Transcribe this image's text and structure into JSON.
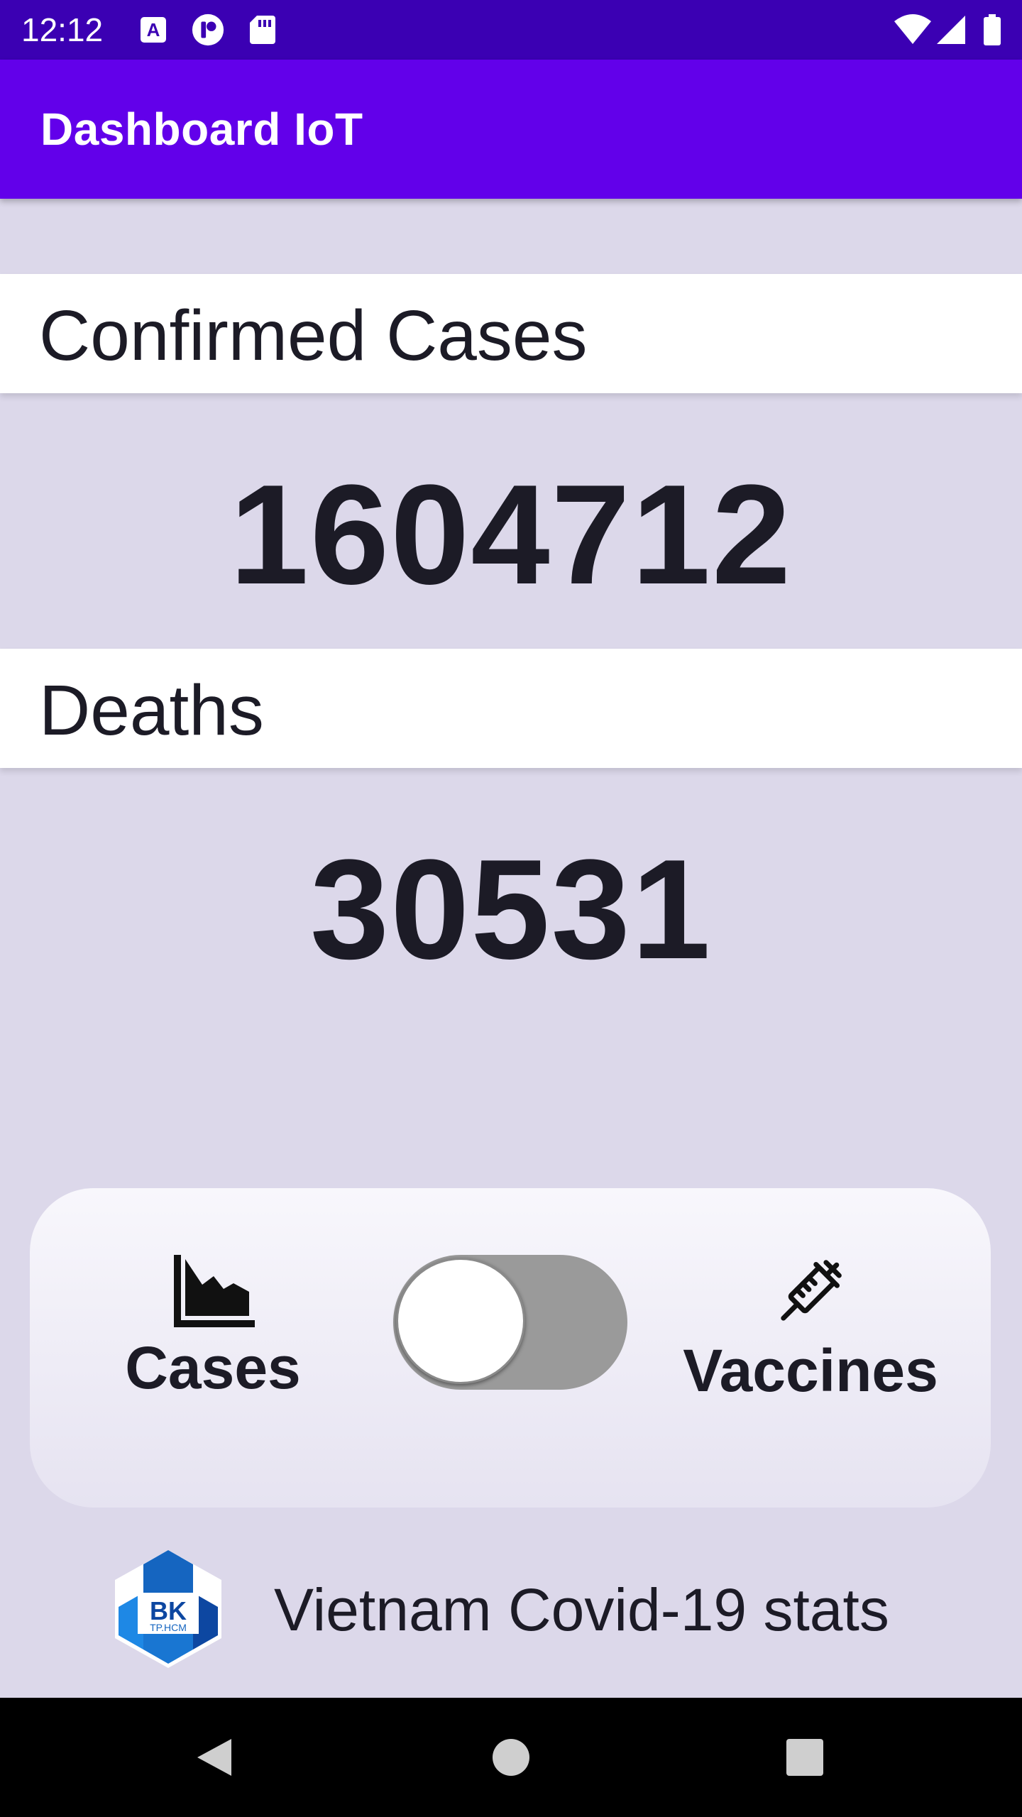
{
  "status_bar": {
    "time": "12:12",
    "icons": [
      "keyboard-a-icon",
      "app-notification-icon",
      "sd-card-icon",
      "wifi-icon",
      "signal-icon",
      "battery-icon"
    ]
  },
  "app_bar": {
    "title": "Dashboard IoT",
    "color": "#6200ea"
  },
  "stats": {
    "confirmed_label": "Confirmed Cases",
    "confirmed_value": "1604712",
    "deaths_label": "Deaths",
    "deaths_value": "30531"
  },
  "toggle": {
    "left_label": "Cases",
    "left_icon": "area-chart-icon",
    "right_label": "Vaccines",
    "right_icon": "syringe-icon",
    "state": "off"
  },
  "footer": {
    "logo": "bk-logo",
    "logo_text": "BK",
    "logo_subtext": "TP.HCM",
    "text": "Vietnam Covid-19 stats"
  },
  "nav_bar": {
    "buttons": [
      "back-icon",
      "home-icon",
      "recents-icon"
    ]
  }
}
